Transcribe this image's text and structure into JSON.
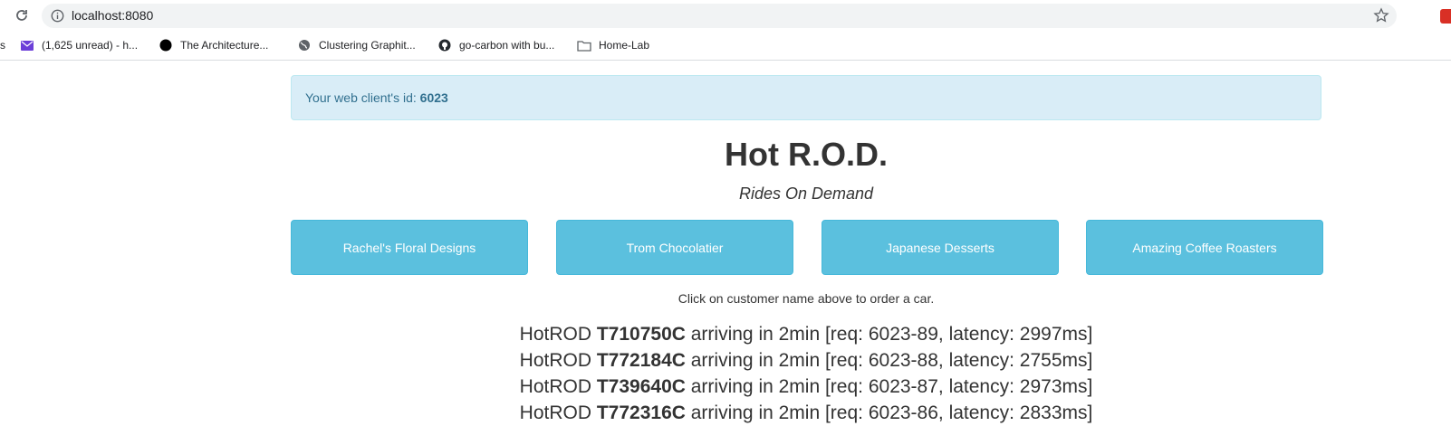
{
  "browser": {
    "url": "localhost:8080",
    "bookmarks": [
      {
        "label": "s",
        "icon": "none"
      },
      {
        "label": "(1,625 unread) - h...",
        "icon": "mail-icon"
      },
      {
        "label": "The Architecture...",
        "icon": "circle-icon"
      },
      {
        "label": "Clustering Graphit...",
        "icon": "globe-icon"
      },
      {
        "label": "go-carbon with bu...",
        "icon": "github-icon"
      },
      {
        "label": "Home-Lab",
        "icon": "folder-icon"
      }
    ]
  },
  "alert": {
    "prefix": "Your web client's id: ",
    "client_id": "6023"
  },
  "header": {
    "title": "Hot R.O.D.",
    "subtitle": "Rides On Demand"
  },
  "customers": [
    {
      "label": "Rachel's Floral Designs"
    },
    {
      "label": "Trom Chocolatier"
    },
    {
      "label": "Japanese Desserts"
    },
    {
      "label": "Amazing Coffee Roasters"
    }
  ],
  "hint": "Click on customer name above to order a car.",
  "rides": [
    {
      "prefix": "HotROD ",
      "car": "T710750C",
      "suffix": " arriving in 2min [req: 6023-89, latency: 2997ms]"
    },
    {
      "prefix": "HotROD ",
      "car": "T772184C",
      "suffix": " arriving in 2min [req: 6023-88, latency: 2755ms]"
    },
    {
      "prefix": "HotROD ",
      "car": "T739640C",
      "suffix": " arriving in 2min [req: 6023-87, latency: 2973ms]"
    },
    {
      "prefix": "HotROD ",
      "car": "T772316C",
      "suffix": " arriving in 2min [req: 6023-86, latency: 2833ms]"
    }
  ]
}
